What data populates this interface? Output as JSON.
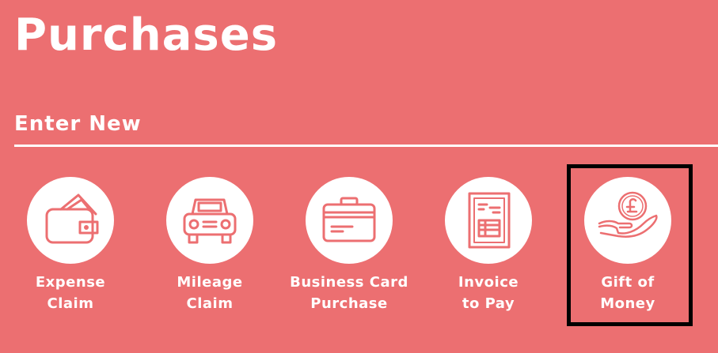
{
  "page": {
    "title": "Purchases",
    "section_title": "Enter New",
    "background_color": "#ec6f71",
    "icon_color": "#ec6f71"
  },
  "tiles": [
    {
      "id": "expense-claim",
      "label_line1": "Expense",
      "label_line2": "Claim",
      "icon": "wallet-icon"
    },
    {
      "id": "mileage-claim",
      "label_line1": "Mileage",
      "label_line2": "Claim",
      "icon": "car-icon"
    },
    {
      "id": "business-card-purchase",
      "label_line1": "Business Card",
      "label_line2": "Purchase",
      "icon": "credit-card-icon"
    },
    {
      "id": "invoice-to-pay",
      "label_line1": "Invoice",
      "label_line2": "to Pay",
      "icon": "invoice-document-icon"
    },
    {
      "id": "gift-of-money",
      "label_line1": "Gift of",
      "label_line2": "Money",
      "icon": "hand-holding-pound-coin-icon",
      "highlighted": true
    }
  ]
}
